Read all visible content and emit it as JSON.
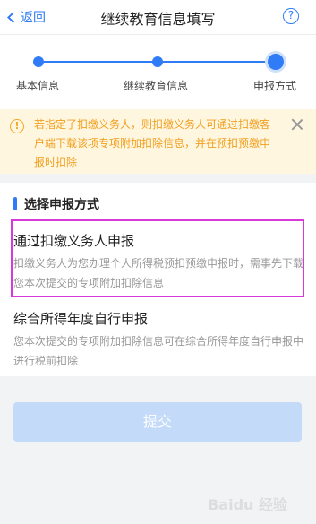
{
  "header": {
    "back_label": "返回",
    "title": "继续教育信息填写",
    "help_label": "?"
  },
  "steps": [
    {
      "label": "基本信息"
    },
    {
      "label": "继续教育信息"
    },
    {
      "label": "申报方式"
    }
  ],
  "notice": {
    "icon_text": "!",
    "text": "若指定了扣缴义务人，则扣缴义务人可通过扣缴客户端下载该项专项附加扣除信息，并在预扣预缴申报时扣除"
  },
  "section": {
    "title": "选择申报方式"
  },
  "options": [
    {
      "title": "通过扣缴义务人申报",
      "desc": "扣缴义务人为您办理个人所得税预扣预缴申报时，需事先下载您本次提交的专项附加扣除信息"
    },
    {
      "title": "综合所得年度自行申报",
      "desc": "您本次提交的专项附加扣除信息可在综合所得年度自行申报中进行税前扣除"
    }
  ],
  "submit_label": "提交",
  "watermark": "Baidu 经验",
  "colors": {
    "accent": "#2f7cf6",
    "notice_bg": "#fff6e0",
    "notice_text": "#f0a020",
    "highlight_border": "#d63ad8",
    "submit_disabled": "#c3daf9"
  }
}
